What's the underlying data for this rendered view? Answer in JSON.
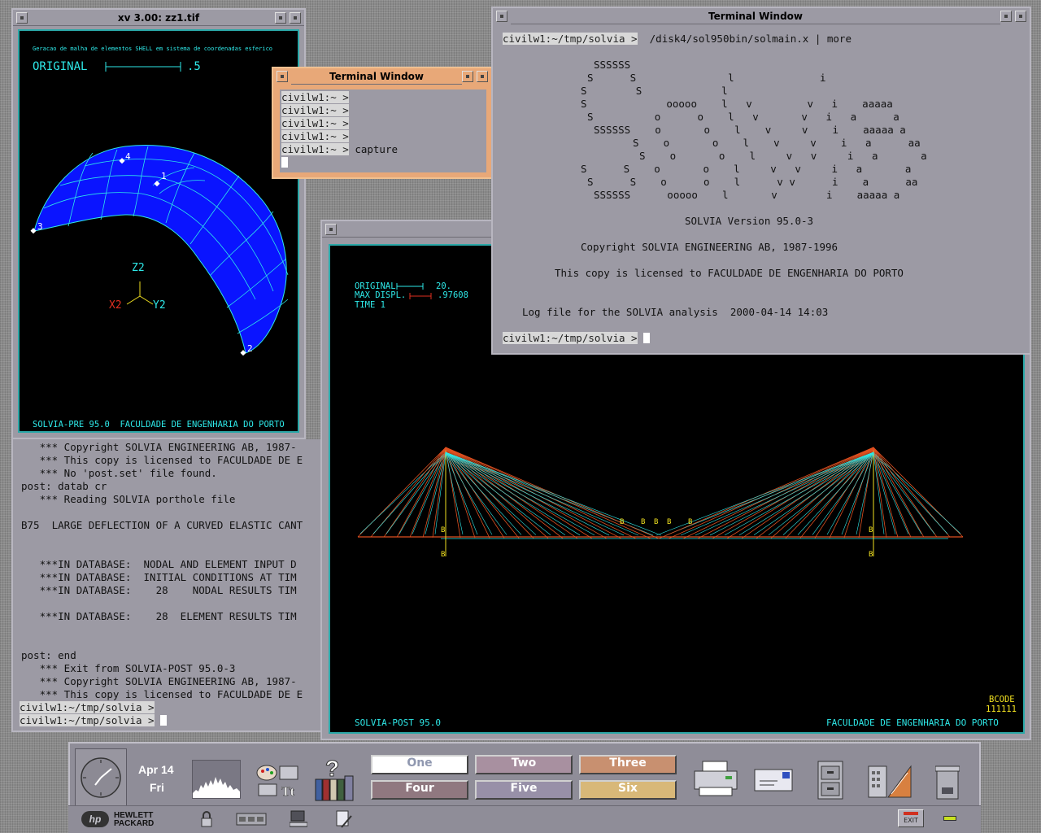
{
  "xv_window": {
    "title": "xv 3.00: zz1.tif",
    "caption": "Geracao de malha de elementos SHELL em sistema de coordenadas esferico",
    "scale_label": "ORIGINAL",
    "scale_value": ".5",
    "node_labels": [
      "1",
      "2",
      "3",
      "4"
    ],
    "axis_labels": {
      "z": "Z2",
      "x": "X2",
      "y": "Y2"
    },
    "footer": "SOLVIA-PRE 95.0  FACULDADE DE ENGENHARIA DO PORTO"
  },
  "small_terminal": {
    "title": "Terminal Window",
    "lines": [
      "civilw1:~ >",
      "civilw1:~ >",
      "civilw1:~ >",
      "civilw1:~ >",
      "civilw1:~ >"
    ],
    "last_command": "capture"
  },
  "main_terminal": {
    "title": "Terminal Window",
    "prompt": "civilw1:~/tmp/solvia >",
    "command": "/disk4/sol950bin/solmain.x | more",
    "banner": [
      "SSSSSS",
      "S      S               l              i",
      "S        S             l",
      "S             ooooo    l   v         v   i    aaaaa",
      "S          o      o    l   v       v   i   a      a",
      "SSSSSS    o       o    l    v     v    i    aaaaa a",
      "S    o       o    l    v     v    i   a      aa",
      "S    o       o    l     v   v     i   a       a",
      "S      S    o       o    l     v   v     i   a       a",
      "S      S    o      o    l      v v      i    a      aa",
      "SSSSSS      ooooo    l       v        i    aaaaa a"
    ],
    "version": "SOLVIA Version 95.0-3",
    "copyright": "Copyright SOLVIA ENGINEERING AB, 1987-1996",
    "license": "This copy is licensed to FACULDADE DE ENGENHARIA DO PORTO",
    "log": "Log file for the SOLVIA analysis  2000-04-14 14:03",
    "final_prompt": "civilw1:~/tmp/solvia >"
  },
  "post_terminal": {
    "lines": [
      "   *** Copyright SOLVIA ENGINEERING AB, 1987-",
      "   *** This copy is licensed to FACULDADE DE E",
      "   *** No 'post.set' file found.",
      "post: datab cr",
      "   *** Reading SOLVIA porthole file",
      "",
      "B75  LARGE DEFLECTION OF A CURVED ELASTIC CANT",
      "",
      "",
      "   ***IN DATABASE:  NODAL AND ELEMENT INPUT D",
      "   ***IN DATABASE:  INITIAL CONDITIONS AT TIM",
      "   ***IN DATABASE:    28    NODAL RESULTS TIM",
      "",
      "   ***IN DATABASE:    28  ELEMENT RESULTS TIM",
      "",
      "",
      "post: end",
      "   *** Exit from SOLVIA-POST 95.0-3",
      "   *** Copyright SOLVIA ENGINEERING AB, 1987-",
      "   *** This copy is licensed to FACULDADE DE E"
    ],
    "prompt1": "civilw1:~/tmp/solvia >",
    "prompt2": "civilw1:~/tmp/solvia >"
  },
  "post_window": {
    "original_label": "ORIGINAL",
    "original_value": "20.",
    "maxdispl_label": "MAX DISPL.",
    "maxdispl_value": ".97608",
    "time_label": "TIME 1",
    "bcode_label": "BCODE",
    "bcode_value": "111111",
    "footer_left": "SOLVIA-POST 95.0",
    "footer_right": "FACULDADE DE ENGENHARIA DO PORTO",
    "boundary_marker": "B"
  },
  "front_panel": {
    "date_month_day": "Apr 14",
    "date_weekday": "Fri",
    "workspaces": [
      "One",
      "Two",
      "Three",
      "Four",
      "Five",
      "Six"
    ],
    "workspace_colors": [
      "#ffffff",
      "#a890a0",
      "#c89070",
      "#907880",
      "#9890a8",
      "#d8b878"
    ],
    "active_workspace": "One",
    "brand_line1": "HEWLETT",
    "brand_line2": "PACKARD",
    "brand_logo": "hp",
    "exit_label": "EXIT"
  }
}
